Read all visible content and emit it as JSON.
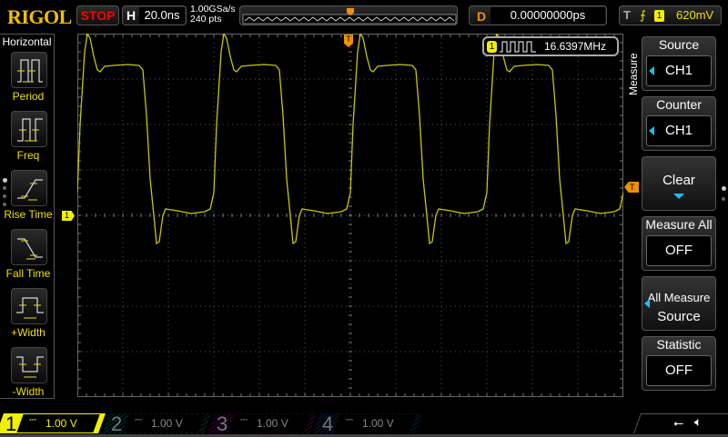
{
  "header": {
    "logo": "RIGOL",
    "run_state": "STOP",
    "h_label": "H",
    "timebase": "20.0ns",
    "sample_rate": "1.00GSa/s",
    "memory_depth": "240 pts",
    "d_label": "D",
    "delay": "0.00000000ps",
    "t_label": "T",
    "trigger_source": "1",
    "trigger_level": "620mV"
  },
  "left_menu": {
    "title": "Horizontal",
    "items": [
      {
        "label": "Period",
        "icon": "period-icon"
      },
      {
        "label": "Freq",
        "icon": "freq-icon"
      },
      {
        "label": "Rise Time",
        "icon": "rise-time-icon"
      },
      {
        "label": "Fall Time",
        "icon": "fall-time-icon"
      },
      {
        "label": "+Width",
        "icon": "positive-width-icon"
      },
      {
        "label": "-Width",
        "icon": "negative-width-icon"
      }
    ]
  },
  "counter": {
    "channel": "1",
    "value": "16.6397MHz"
  },
  "ch1_marker": "1",
  "trigger_marker": "T",
  "right_menu": {
    "title": "Measure",
    "source_label": "Source",
    "source_value": "CH1",
    "counter_label": "Counter",
    "counter_value": "CH1",
    "clear_label": "Clear",
    "measure_all_label": "Measure All",
    "measure_all_value": "OFF",
    "all_source_line1": "All Measure",
    "all_source_line2": "Source",
    "statistic_label": "Statistic",
    "statistic_value": "OFF"
  },
  "channels": [
    {
      "num": "1",
      "scale": "1.00 V",
      "color": "#f0f000"
    },
    {
      "num": "2",
      "scale": "1.00 V",
      "color": "#00a08c"
    },
    {
      "num": "3",
      "scale": "1.00 V",
      "color": "#c000c0"
    },
    {
      "num": "4",
      "scale": "1.00 V",
      "color": "#1060c0"
    }
  ],
  "colors": {
    "ch1": "#c8c800",
    "accent": "#1ec0f0",
    "trigger": "#f39000"
  }
}
